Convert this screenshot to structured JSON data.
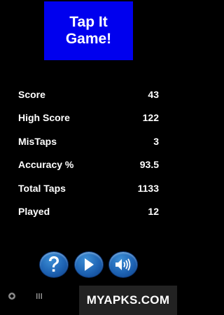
{
  "title": "Tap It Game!",
  "stats": [
    {
      "label": "Score",
      "value": "43"
    },
    {
      "label": "High Score",
      "value": "122"
    },
    {
      "label": "MisTaps",
      "value": "3"
    },
    {
      "label": "Accuracy %",
      "value": "93.5"
    },
    {
      "label": "Total Taps",
      "value": "1133"
    },
    {
      "label": "Played",
      "value": "12"
    }
  ],
  "buttons": {
    "help_icon": "question-mark-icon",
    "play_icon": "play-icon",
    "sound_icon": "speaker-icon"
  },
  "nav": {
    "left_icon": "circle-logo-icon",
    "menu_icon": "recent-apps-icon"
  },
  "watermark": "MYAPKS.COM",
  "colors": {
    "background": "#000000",
    "title_bg": "#0000ee",
    "text": "#ffffff",
    "button_blue": "#1e63b3"
  }
}
